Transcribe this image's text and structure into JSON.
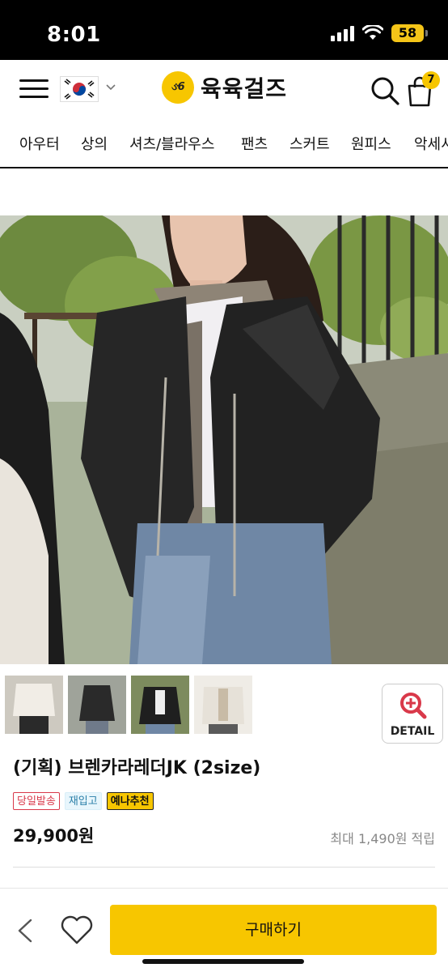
{
  "status_bar": {
    "time": "8:01",
    "battery": "58"
  },
  "header": {
    "logo_text": "육육걸즈",
    "logo_mark": "ઙ6",
    "cart_count": "7"
  },
  "categories": [
    "아우터",
    "상의",
    "셔츠/블라우스",
    "팬츠",
    "스커트",
    "원피스",
    "악세서리"
  ],
  "detail_button": {
    "label": "DETAIL"
  },
  "product": {
    "title": "(기획) 브렌카라레더JK (2size)",
    "badges": [
      "당일발송",
      "재입고",
      "예나추천"
    ],
    "price": "29,900원",
    "points": "최대 1,490원 적립"
  },
  "bottom_bar": {
    "buy_label": "구매하기"
  },
  "colors": {
    "accent": "#f7c600",
    "badge_red": "#d9394a",
    "badge_blue": "#2a7fa8"
  },
  "icons": [
    "hamburger-icon",
    "korea-flag-icon",
    "chevron-down-icon",
    "search-icon",
    "cart-icon",
    "zoom-in-icon",
    "back-chevron-icon",
    "heart-icon"
  ]
}
